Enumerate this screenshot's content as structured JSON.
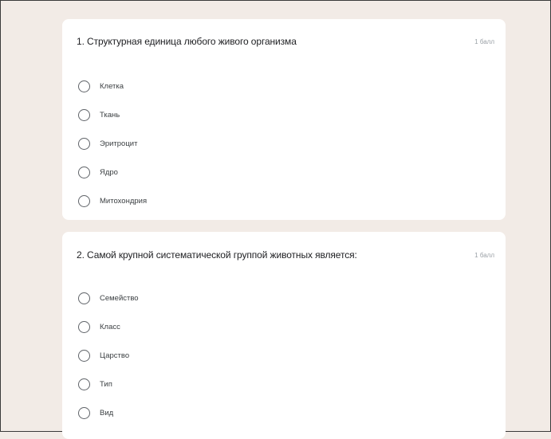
{
  "questions": [
    {
      "title": "1. Структурная единица любого живого организма",
      "points": "1 балл",
      "options": [
        "Клетка",
        "Ткань",
        "Эритроцит",
        "Ядро",
        "Митохондрия"
      ]
    },
    {
      "title": "2. Самой крупной систематической группой животных является:",
      "points": "1 балл",
      "options": [
        "Семейство",
        "Класс",
        "Царство",
        "Тип",
        "Вид"
      ]
    }
  ]
}
